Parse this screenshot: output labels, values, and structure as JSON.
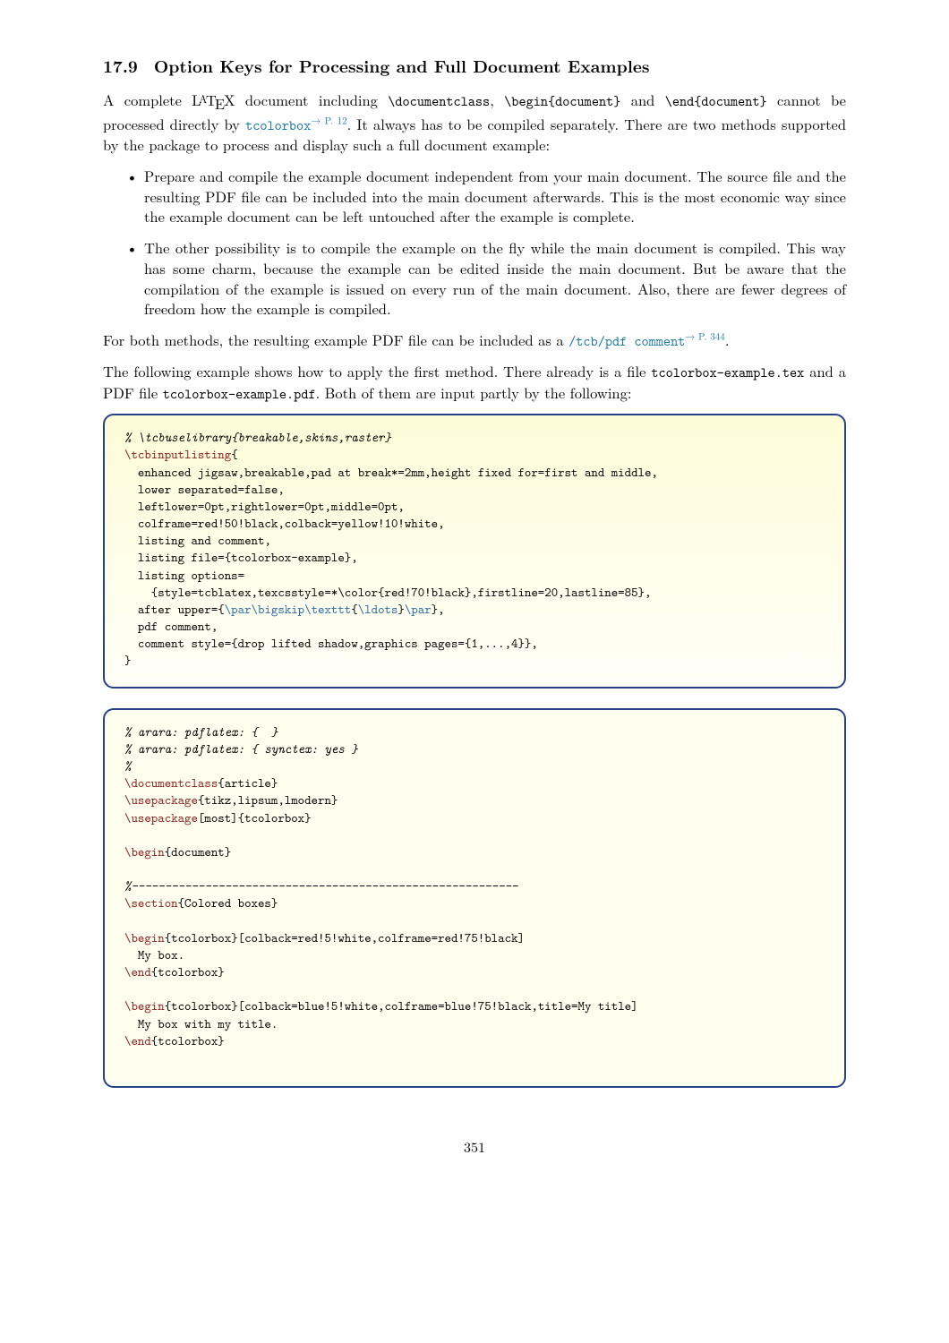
{
  "section": {
    "number": "17.9",
    "title": "Option Keys for Processing and Full Document Examples"
  },
  "intro": {
    "pre": "A complete ",
    "latex": "LᴬTᴇX",
    "mid": " document including ",
    "cmd_docclass": "\\documentclass",
    "mid2": ", ",
    "cmd_begin": "\\begin{document}",
    "mid3": " and ",
    "cmd_end": "\\end{document}",
    "mid4": " cannot be processed directly by ",
    "link_tcb": "tcolorbox",
    "pref_tcb": "→ P. 12",
    "tail": ". It always has to be compiled separately. There are two methods supported by the package to process and display such a full document example:"
  },
  "bullets": [
    "Prepare and compile the example document independent from your main document. The source file and the resulting PDF file can be included into the main document afterwards. This is the most economic way since the example document can be left untouched after the example is complete.",
    "The other possibility is to compile the example on the fly while the main document is compiled. This way has some charm, because the example can be edited inside the main document. But be aware that the compilation of the example is issued on every run of the main document. Also, there are fewer degrees of freedom how the example is compiled."
  ],
  "para2": {
    "pre": "For both methods, the resulting example PDF file can be included as a ",
    "link_pdf": "/tcb/pdf comment",
    "pref_pdf": "→ P. 344",
    "tail": "."
  },
  "para3": {
    "pre": "The following example shows how to apply the first method. There already is a file ",
    "f1": "tcolorbox-example.tex",
    "mid": " and a PDF file ",
    "f2": "tcolorbox-example.pdf",
    "tail": ". Both of them are input partly by the following:"
  },
  "code1": {
    "l01a": "% ",
    "l01b": "\\tcbuselibrary{breakable,skins,raster}",
    "l02": "\\tcbinputlisting",
    "l02b": "{",
    "l03": "  enhanced jigsaw,breakable,pad at break*=2mm,height fixed for=first and middle,",
    "l04": "  lower separated=false,",
    "l05": "  leftlower=0pt,rightlower=0pt,middle=0pt,",
    "l06": "  colframe=red!50!black,colback=yellow!10!white,",
    "l07": "  listing and comment,",
    "l08": "  listing file={tcolorbox-example},",
    "l09": "  listing options=",
    "l10": "    {style=tcblatex,texcsstyle=*\\color{red!70!black},firstline=20,lastline=85},",
    "l11a": "  after upper={",
    "l11b": "\\par\\bigskip\\texttt",
    "l11c": "{",
    "l11d": "\\ldots",
    "l11e": "}",
    "l11f": "\\par",
    "l11g": "},",
    "l12": "  pdf comment,",
    "l13": "  comment style={drop lifted shadow,graphics pages={1,...,4}},",
    "l14": "}"
  },
  "code2": {
    "l01": "% arara: pdflatex: {  }",
    "l02": "% arara: pdflatex: { synctex: yes }",
    "l03": "%",
    "l04a": "\\documentclass",
    "l04b": "{article}",
    "l05a": "\\usepackage",
    "l05b": "{tikz,lipsum,lmodern}",
    "l06a": "\\usepackage",
    "l06b": "[most]{tcolorbox}",
    "l08a": "\\begin",
    "l08b": "{document}",
    "l10": "%----------------------------------------------------------",
    "l11a": "\\section",
    "l11b": "{Colored boxes}",
    "l13a": "\\begin",
    "l13b": "{tcolorbox}[colback=red!5!white,colframe=red!75!black]",
    "l14": "  My box.",
    "l15a": "\\end",
    "l15b": "{tcolorbox}",
    "l17a": "\\begin",
    "l17b": "{tcolorbox}[colback=blue!5!white,colframe=blue!75!black,title=My title]",
    "l18": "  My box with my title.",
    "l19a": "\\end",
    "l19b": "{tcolorbox}"
  },
  "pagenum": "351"
}
